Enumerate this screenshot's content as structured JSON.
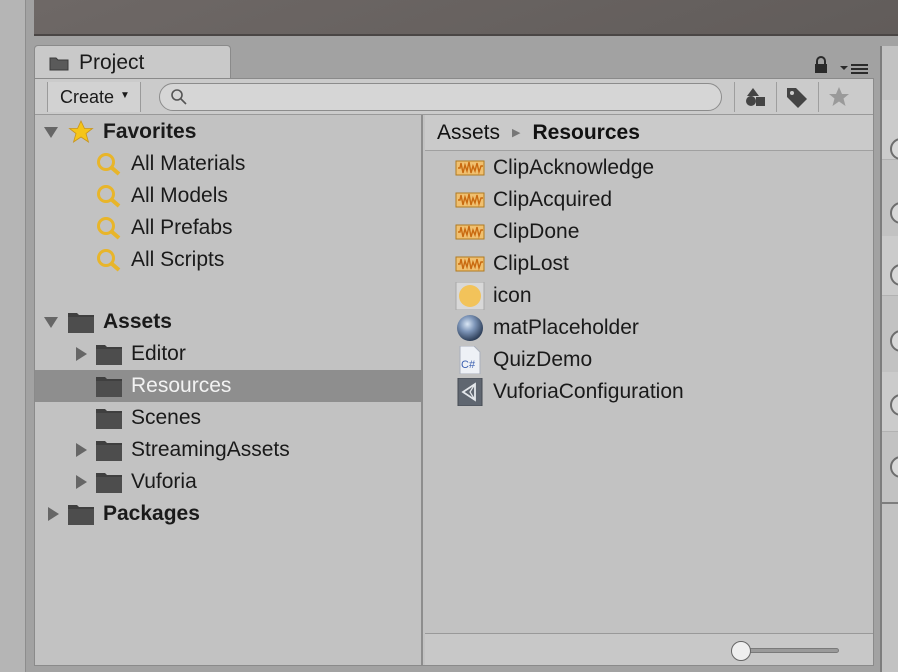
{
  "window": {
    "tab_title": "Project"
  },
  "toolbar": {
    "create_label": "Create",
    "create_caret": "▼",
    "search_placeholder": "",
    "search_value": ""
  },
  "tree": {
    "favorites": {
      "label": "Favorites",
      "items": [
        "All Materials",
        "All Models",
        "All Prefabs",
        "All Scripts"
      ]
    },
    "assets": {
      "label": "Assets",
      "children": [
        {
          "label": "Editor",
          "expandable": true
        },
        {
          "label": "Resources",
          "expandable": false,
          "selected": true
        },
        {
          "label": "Scenes",
          "expandable": false
        },
        {
          "label": "StreamingAssets",
          "expandable": true
        },
        {
          "label": "Vuforia",
          "expandable": true
        }
      ]
    },
    "packages": {
      "label": "Packages"
    }
  },
  "breadcrumb": {
    "root": "Assets",
    "separator": "▶",
    "current": "Resources"
  },
  "assets": [
    {
      "name": "ClipAcknowledge",
      "icon": "audio-clip-icon"
    },
    {
      "name": "ClipAcquired",
      "icon": "audio-clip-icon"
    },
    {
      "name": "ClipDone",
      "icon": "audio-clip-icon"
    },
    {
      "name": "ClipLost",
      "icon": "audio-clip-icon"
    },
    {
      "name": "icon",
      "icon": "texture-icon"
    },
    {
      "name": "matPlaceholder",
      "icon": "material-sphere-icon"
    },
    {
      "name": "QuizDemo",
      "icon": "csharp-script-icon"
    },
    {
      "name": "VuforiaConfiguration",
      "icon": "scriptable-object-icon"
    }
  ],
  "icons": {
    "csharp_label": "C#"
  },
  "footer": {
    "thumbnail_size": 0
  },
  "colors": {
    "selected_row": "#8e8e8e",
    "panel_bg": "#c2c2c2",
    "audio_orange": "#e8a230",
    "folder_dark": "#3f3f3f",
    "favorites_star": "#f5c518"
  }
}
